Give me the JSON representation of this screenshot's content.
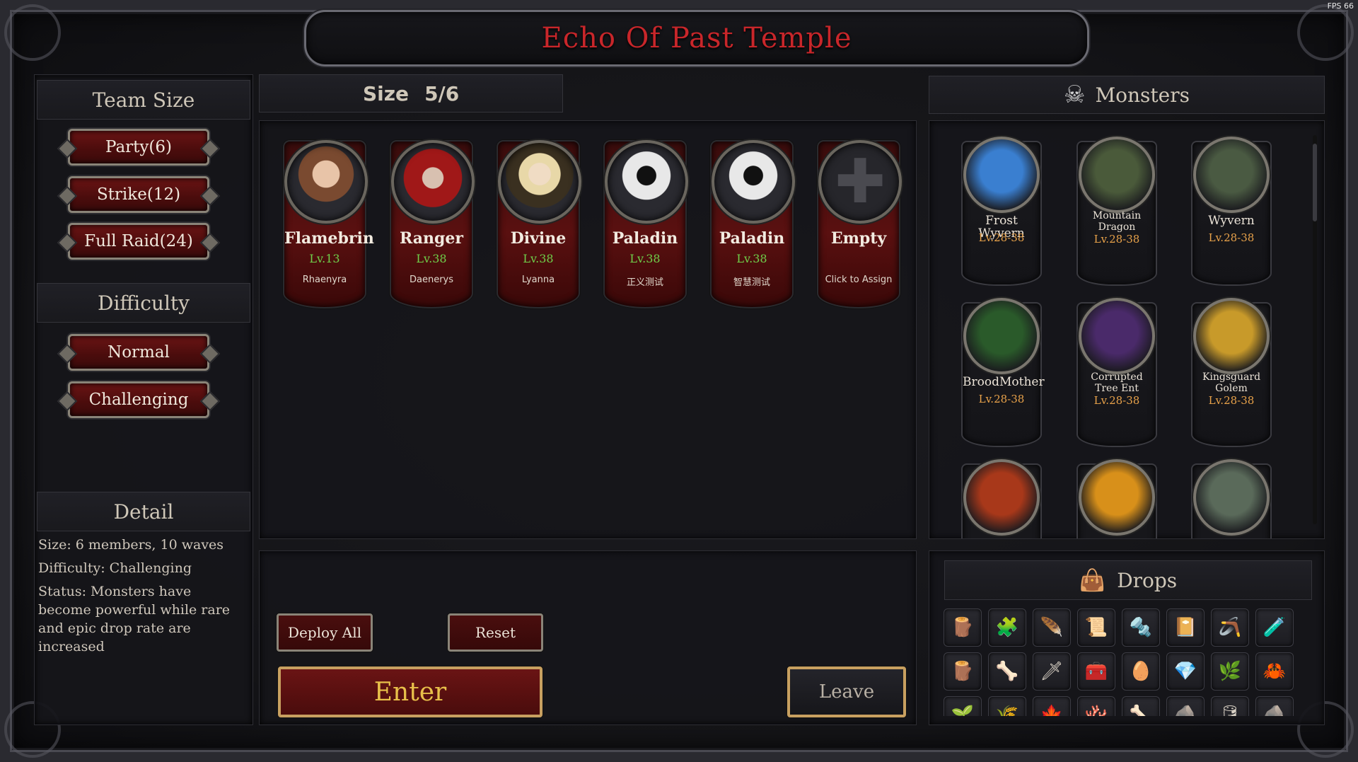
{
  "title": "Echo Of Past Temple",
  "fps": "FPS 66",
  "team_size": {
    "heading": "Team Size",
    "options": [
      "Party(6)",
      "Strike(12)",
      "Full Raid(24)"
    ]
  },
  "difficulty": {
    "heading": "Difficulty",
    "options": [
      "Normal",
      "Challenging"
    ]
  },
  "detail": {
    "heading": "Detail",
    "size": "Size: 6 members, 10 waves",
    "difficulty": "Difficulty:  Challenging",
    "status": "Status:  Monsters have become powerful while rare and epic drop rate are increased"
  },
  "party": {
    "size_label": "Size",
    "size_value": "5/6",
    "members": [
      {
        "name": "Flamebrin",
        "level": "Lv.13",
        "player": "Rhaenyra"
      },
      {
        "name": "Ranger",
        "level": "Lv.38",
        "player": "Daenerys"
      },
      {
        "name": "Divine",
        "level": "Lv.38",
        "player": "Lyanna"
      },
      {
        "name": "Paladin",
        "level": "Lv.38",
        "player": "正义测试"
      },
      {
        "name": "Paladin",
        "level": "Lv.38",
        "player": "智慧测试"
      },
      {
        "name": "Empty",
        "level": "",
        "player": "Click to Assign"
      }
    ]
  },
  "actions": {
    "deploy_all": "Deploy All",
    "reset": "Reset",
    "enter": "Enter",
    "leave": "Leave"
  },
  "monsters": {
    "heading": "Monsters",
    "list": [
      {
        "name": "Frost Wyvern",
        "level": "Lv.28-38",
        "color": "#3a7fd0"
      },
      {
        "name": "Mountain Dragon",
        "level": "Lv.28-38",
        "color": "#4a5a3a"
      },
      {
        "name": "Wyvern",
        "level": "Lv.28-38",
        "color": "#4a5a42"
      },
      {
        "name": "BroodMother",
        "level": "Lv.28-38",
        "color": "#2a5a2a"
      },
      {
        "name": "Corrupted Tree Ent",
        "level": "Lv.28-38",
        "color": "#4a2a6a"
      },
      {
        "name": "Kingsguard Golem",
        "level": "Lv.28-38",
        "color": "#c89a2a"
      },
      {
        "name": "",
        "level": "",
        "color": "#a8381a"
      },
      {
        "name": "",
        "level": "",
        "color": "#d8901a"
      },
      {
        "name": "",
        "level": "",
        "color": "#5a6a5a"
      }
    ]
  },
  "drops": {
    "heading": "Drops",
    "items": [
      "🪵",
      "🧩",
      "🪶",
      "📜",
      "🔩",
      "📔",
      "🪃",
      "🧪",
      "🪵",
      "🦴",
      "🗡",
      "🧰",
      "🥚",
      "💎",
      "🌿",
      "🦀",
      "🌱",
      "🌾",
      "🍁",
      "🪸",
      "🦴",
      "🪨",
      "🛢",
      "🪨"
    ]
  }
}
